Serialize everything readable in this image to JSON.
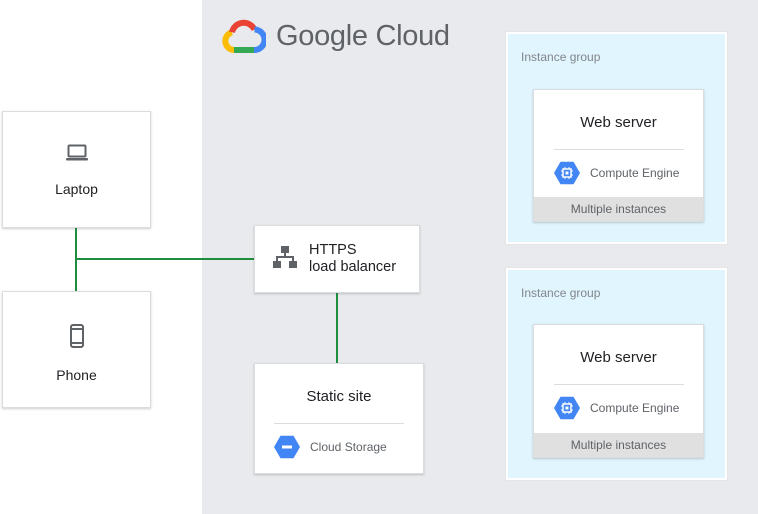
{
  "brand": {
    "name": "Google Cloud"
  },
  "clients": [
    {
      "label": "Laptop",
      "icon": "laptop-icon"
    },
    {
      "label": "Phone",
      "icon": "phone-icon"
    }
  ],
  "load_balancer": {
    "line1": "HTTPS",
    "line2": "load balancer",
    "icon": "load-balancer-icon"
  },
  "static_site": {
    "title": "Static site",
    "product": "Cloud Storage",
    "icon": "cloud-storage-icon"
  },
  "instance_groups": [
    {
      "label": "Instance group",
      "title": "Web server",
      "product": "Compute Engine",
      "footer": "Multiple instances",
      "icon": "compute-engine-icon"
    },
    {
      "label": "Instance group",
      "title": "Web server",
      "product": "Compute Engine",
      "footer": "Multiple instances",
      "icon": "compute-engine-icon"
    }
  ],
  "colors": {
    "connector": "#1e8e3e",
    "gcp_background": "#e8eaed",
    "instance_group_fill": "#e1f5fe",
    "product_blue": "#4285f4",
    "google_blue": "#4285f4",
    "google_red": "#ea4335",
    "google_yellow": "#fbbc04",
    "google_green": "#34a853"
  }
}
